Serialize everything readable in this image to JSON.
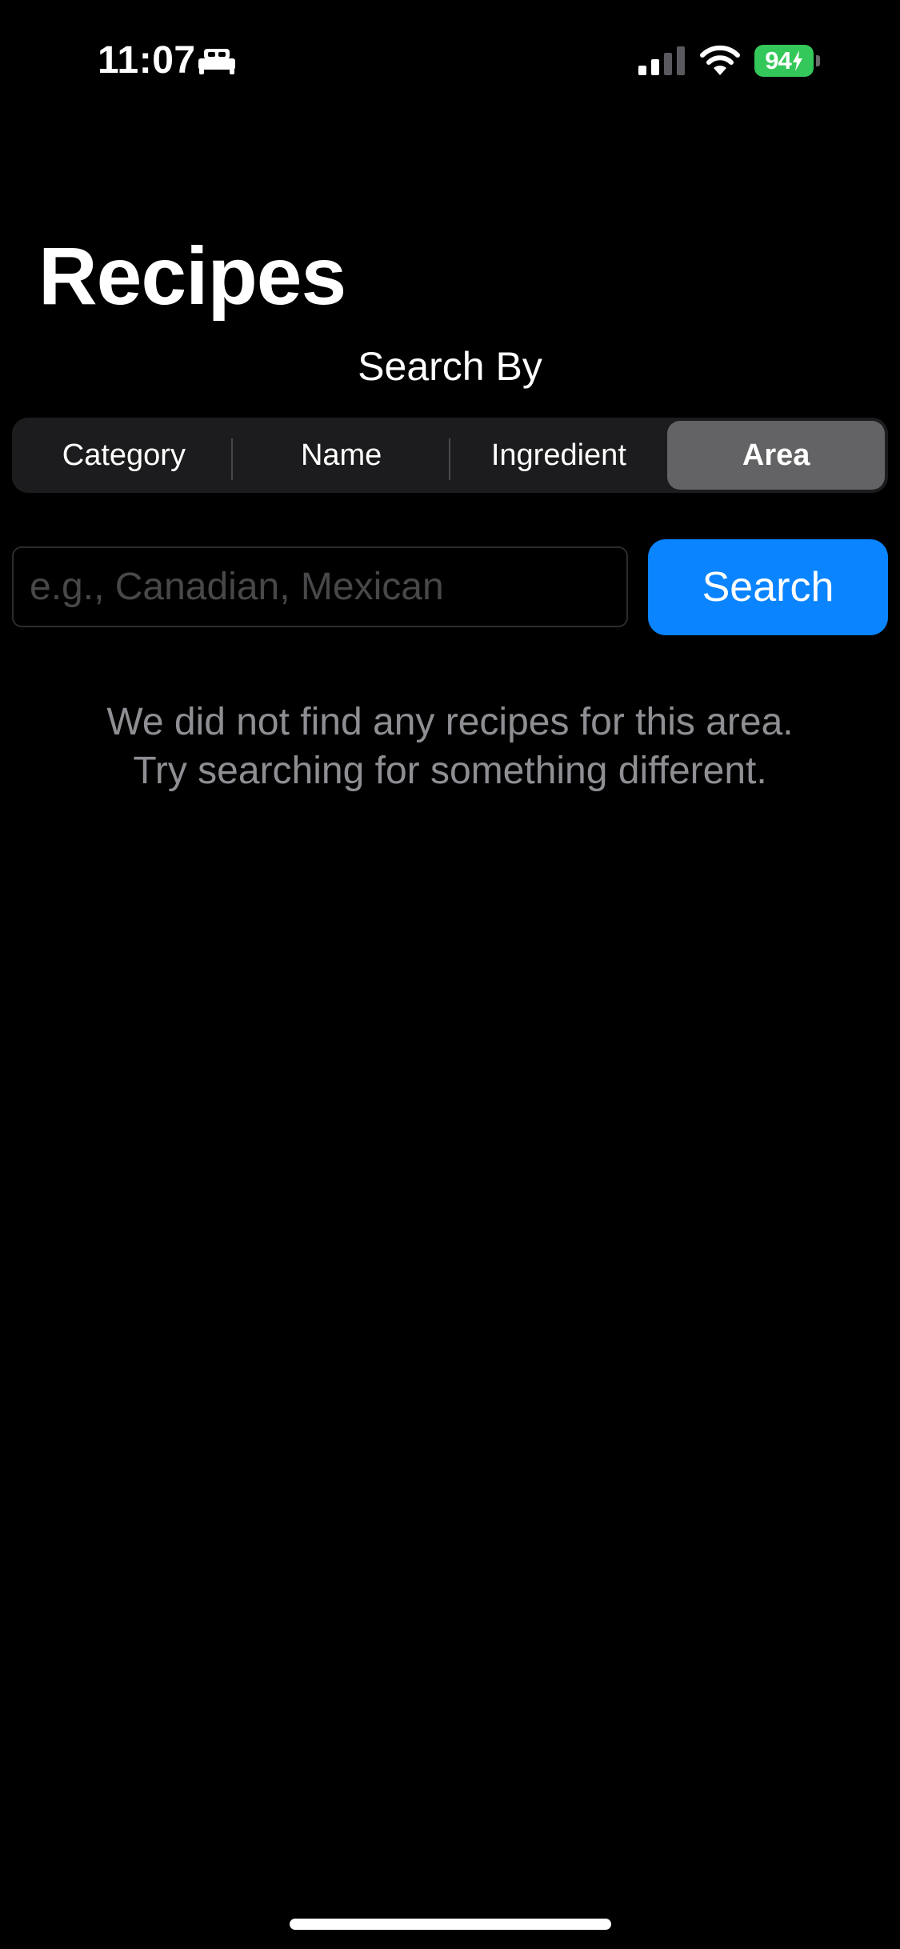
{
  "status_bar": {
    "time": "11:07",
    "battery_percent": "94",
    "battery_level": 0.94,
    "battery_color": "#34c759",
    "icons": [
      "sleep-focus-icon",
      "cellular-signal-icon",
      "wifi-icon",
      "battery-charging-icon"
    ]
  },
  "header": {
    "title": "Recipes"
  },
  "search_by": {
    "label": "Search By",
    "segments": [
      {
        "label": "Category",
        "selected": false
      },
      {
        "label": "Name",
        "selected": false
      },
      {
        "label": "Ingredient",
        "selected": false
      },
      {
        "label": "Area",
        "selected": true
      }
    ]
  },
  "search": {
    "value": "",
    "placeholder": "e.g., Canadian, Mexican",
    "button_label": "Search",
    "button_color": "#0a84ff"
  },
  "empty_state": {
    "line1": "We did not find any recipes for this area.",
    "line2": "Try searching for something different."
  }
}
